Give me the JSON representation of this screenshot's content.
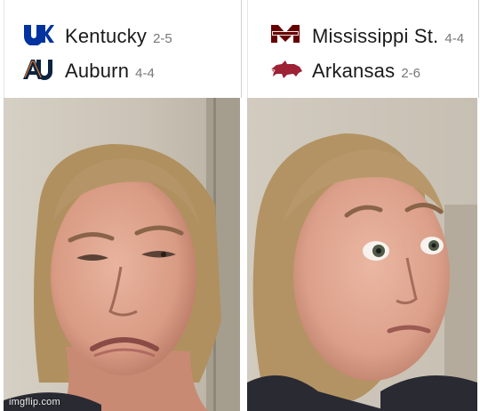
{
  "left_matchup": {
    "team1": {
      "name": "Kentucky",
      "record": "2-5",
      "logo": "kentucky-uk-logo"
    },
    "team2": {
      "name": "Auburn",
      "record": "4-4",
      "logo": "auburn-au-logo"
    }
  },
  "right_matchup": {
    "team1": {
      "name": "Mississippi St.",
      "record": "4-4",
      "logo": "mississippi-state-logo"
    },
    "team2": {
      "name": "Arkansas",
      "record": "2-6",
      "logo": "arkansas-razorback-logo"
    }
  },
  "reactions": {
    "left": "disgusted-face",
    "right": "interested-face"
  },
  "watermark": "imgflip.com",
  "colors": {
    "kentucky_blue": "#0033A0",
    "auburn_navy": "#0C2340",
    "auburn_orange": "#E87722",
    "msstate_maroon": "#660000",
    "arkansas_red": "#9D2235"
  }
}
